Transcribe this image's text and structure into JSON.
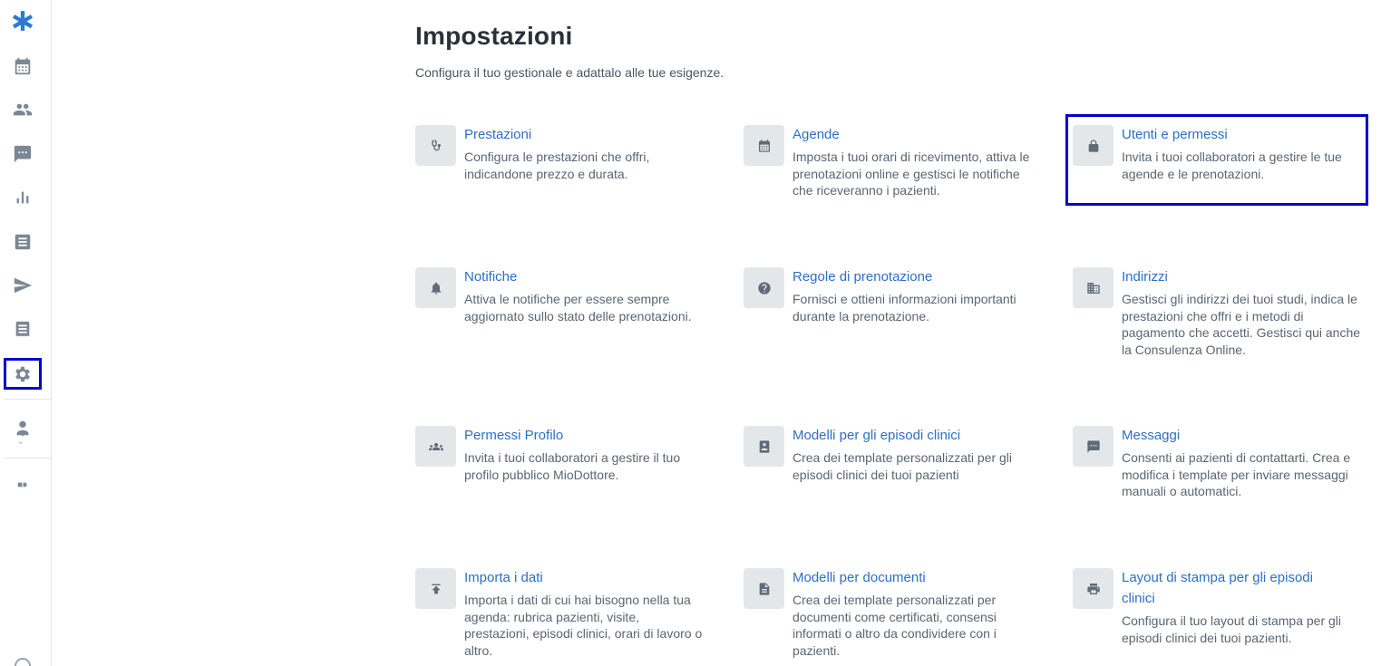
{
  "page": {
    "title": "Impostazioni",
    "subtitle": "Configura il tuo gestionale e adattalo alle tue esigenze."
  },
  "sidebar": {
    "items": [
      {
        "name": "logo",
        "icon": "brand-logo-icon"
      },
      {
        "name": "calendar",
        "icon": "calendar-icon"
      },
      {
        "name": "patients",
        "icon": "people-icon"
      },
      {
        "name": "messages",
        "icon": "chat-icon"
      },
      {
        "name": "statistics",
        "icon": "bar-chart-icon"
      },
      {
        "name": "documents",
        "icon": "list-icon"
      },
      {
        "name": "campaigns",
        "icon": "send-icon"
      },
      {
        "name": "invoices",
        "icon": "receipt-icon"
      },
      {
        "name": "settings",
        "icon": "gear-icon",
        "active": true
      },
      {
        "name": "profile",
        "icon": "doctor-icon"
      },
      {
        "name": "integrations",
        "icon": "integrations-icon"
      }
    ]
  },
  "cards": [
    {
      "title": "Prestazioni",
      "desc": "Configura le prestazioni che offri, indicandone prezzo e durata.",
      "icon": "stethoscope-icon"
    },
    {
      "title": "Agende",
      "desc": "Imposta i tuoi orari di ricevimento, attiva le prenotazioni online e gestisci le notifiche che riceveranno i pazienti.",
      "icon": "calendar-icon"
    },
    {
      "title": "Utenti e permessi",
      "desc": "Invita i tuoi collaboratori a gestire le tue agende e le prenotazioni.",
      "icon": "lock-icon"
    },
    {
      "title": "Notifiche",
      "desc": "Attiva le notifiche per essere sempre aggiornato sullo stato delle prenotazioni.",
      "icon": "bell-icon"
    },
    {
      "title": "Regole di prenotazione",
      "desc": "Fornisci e ottieni informazioni importanti durante la prenotazione.",
      "icon": "help-icon"
    },
    {
      "title": "Indirizzi",
      "desc": "Gestisci gli indirizzi dei tuoi studi, indica le prestazioni che offri e i metodi di pagamento che accetti. Gestisci qui anche la Consulenza Online.",
      "icon": "building-icon"
    },
    {
      "title": "Permessi Profilo",
      "desc": "Invita i tuoi collaboratori a gestire il tuo profilo pubblico MioDottore.",
      "icon": "group-icon"
    },
    {
      "title": "Modelli per gli episodi clinici",
      "desc": "Crea dei template personalizzati per gli episodi clinici dei tuoi pazienti",
      "icon": "contact-book-icon"
    },
    {
      "title": "Messaggi",
      "desc": "Consenti ai pazienti di contattarti. Crea e modifica i template per inviare messaggi manuali o automatici.",
      "icon": "chat-icon"
    },
    {
      "title": "Importa i dati",
      "desc": "Importa i dati di cui hai bisogno nella tua agenda: rubrica pazienti, visite, prestazioni, episodi clinici, orari di lavoro o altro.",
      "icon": "upload-icon"
    },
    {
      "title": "Modelli per documenti",
      "desc": "Crea dei template personalizzati per documenti come certificati, consensi informati o altro da condividere con i pazienti.",
      "icon": "document-icon"
    },
    {
      "title": "Layout di stampa per gli episodi clinici",
      "desc": "Configura il tuo layout di stampa per gli episodi clinici dei tuoi pazienti.",
      "icon": "printer-icon"
    }
  ],
  "colors": {
    "accent": "#2c6fc4",
    "highlight": "#0000cc",
    "tile": "#e4e7ea"
  }
}
